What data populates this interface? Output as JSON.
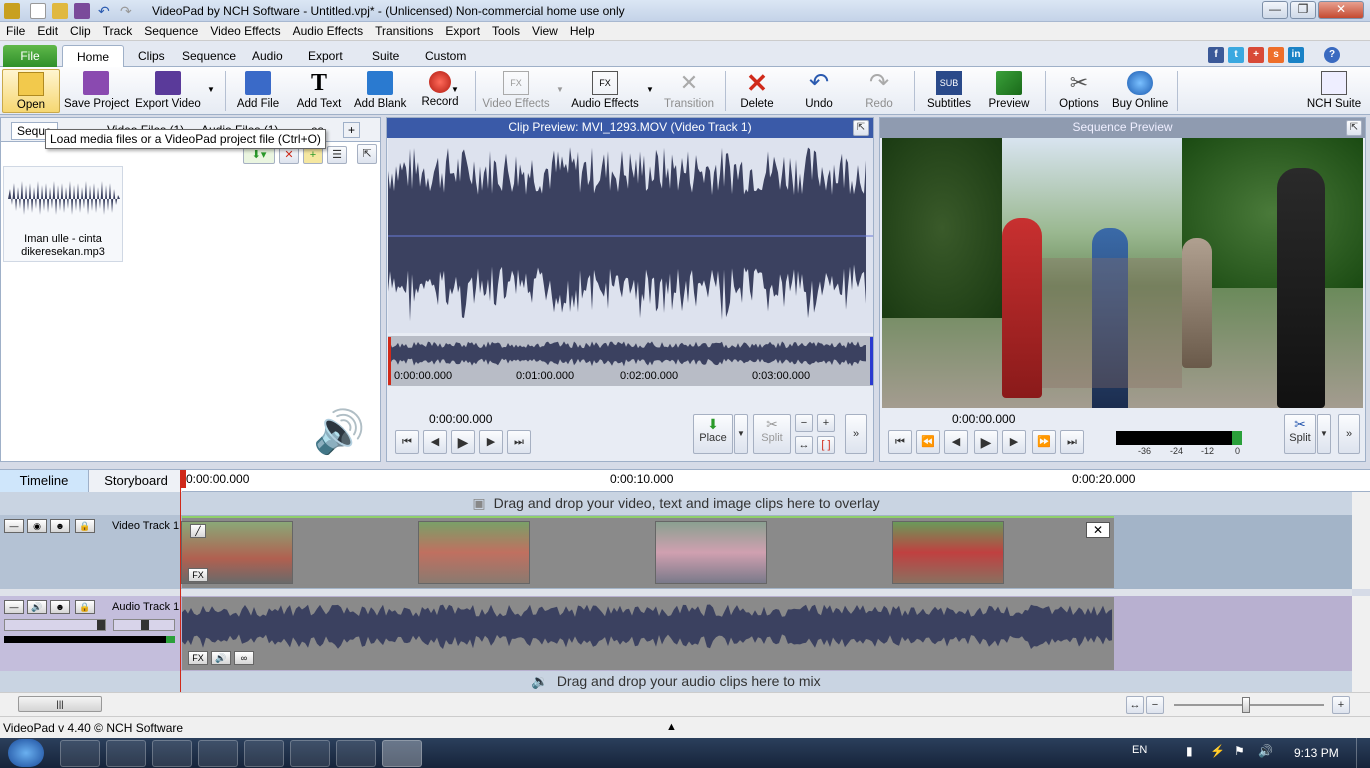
{
  "window": {
    "title": "VideoPad by NCH Software - Untitled.vpj* - (Unlicensed) Non-commercial home use only",
    "controls": {
      "minimize": "—",
      "maximize": "❐",
      "close": "✕"
    }
  },
  "menu": [
    "File",
    "Edit",
    "Clip",
    "Track",
    "Sequence",
    "Video Effects",
    "Audio Effects",
    "Transitions",
    "Export",
    "Tools",
    "View",
    "Help"
  ],
  "ribbon_tabs": [
    "File",
    "Home",
    "Clips",
    "Sequence",
    "Audio",
    "Export",
    "Suite",
    "Custom"
  ],
  "toolbar": {
    "open": "Open",
    "save_project": "Save Project",
    "export_video": "Export Video",
    "add_file": "Add File",
    "add_text": "Add Text",
    "add_blank": "Add Blank",
    "record": "Record",
    "video_effects": "Video Effects",
    "audio_effects": "Audio Effects",
    "transition": "Transition",
    "delete": "Delete",
    "undo": "Undo",
    "redo": "Redo",
    "subtitles": "Subtitles",
    "subtitles_icon_text": "SUB",
    "preview": "Preview",
    "options": "Options",
    "buy_online": "Buy Online",
    "nch_suite": "NCH Suite",
    "fx_text": "FX"
  },
  "social": {
    "f": "f",
    "t": "t",
    "g": "+",
    "s": "s",
    "in": "in",
    "help": "?"
  },
  "bin": {
    "tabs": [
      "Seque",
      "Video Files (1)",
      "Audio Files (1)",
      "es",
      "+"
    ],
    "tooltip": "Load media files or a VideoPad project file (Ctrl+O)",
    "file_name": "Iman ulle - cinta dikeresekan.mp3"
  },
  "clip_preview": {
    "title": "Clip Preview: MVI_1293.MOV (Video Track 1)",
    "timecode": "0:00:00.000",
    "ruler": [
      "0:00:00.000",
      "0:01:00.000",
      "0:02:00.000",
      "0:03:00.000"
    ],
    "place": "Place",
    "split": "Split"
  },
  "sequence_preview": {
    "title": "Sequence Preview",
    "timecode": "0:00:00.000",
    "meter_labels": [
      "-36",
      "-24",
      "-12",
      "0"
    ],
    "split": "Split"
  },
  "timeline": {
    "tabs": [
      "Timeline",
      "Storyboard"
    ],
    "ruler": [
      "0:00:00.000",
      "0:00:10.000",
      "0:00:20.000"
    ],
    "overlay_hint": "Drag and drop your video, text and image clips here to overlay",
    "video_track": "Video Track 1",
    "audio_track": "Audio Track 1",
    "mix_hint": "Drag and drop your audio clips here to mix",
    "fx_label": "FX"
  },
  "status": {
    "text": "VideoPad v 4.40 © NCH Software"
  },
  "taskbar": {
    "lang": "EN",
    "time": "9:13 PM"
  },
  "colors": {
    "accent": "#3a5aa8",
    "wave": "#3b4160",
    "green": "#2f8f2a"
  }
}
